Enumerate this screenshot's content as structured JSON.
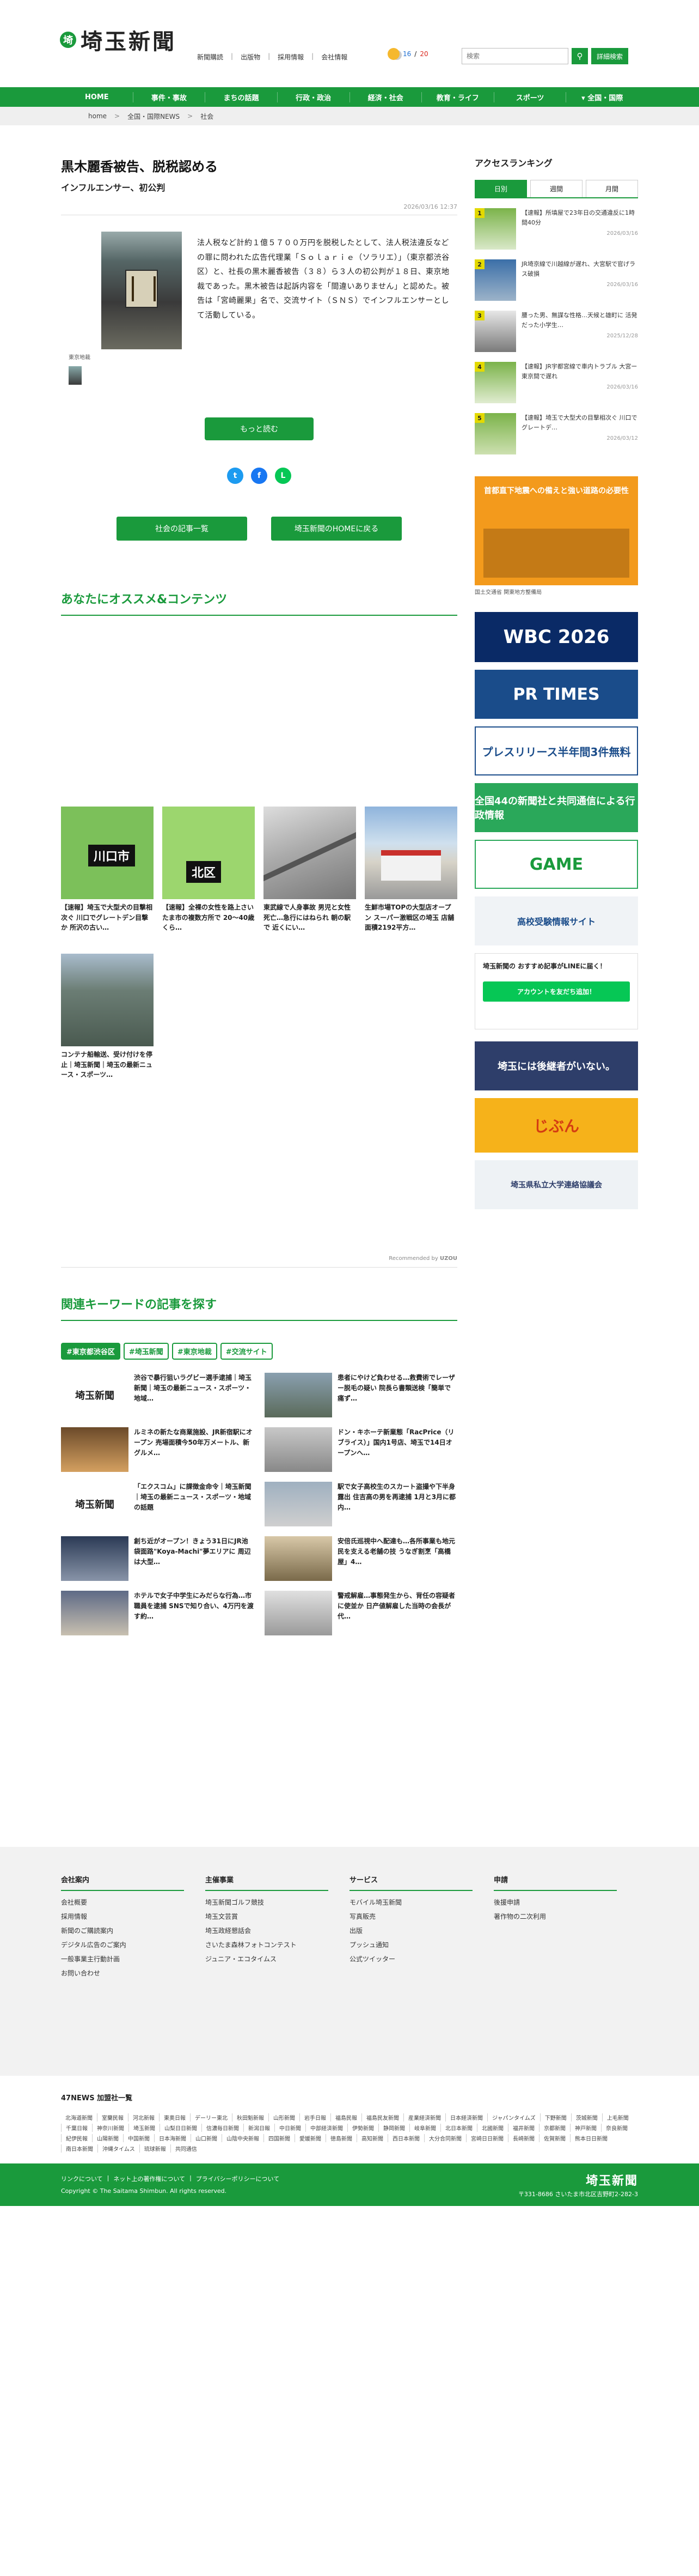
{
  "header": {
    "logo_mark": "埼",
    "logo_text": "埼玉新聞",
    "links": [
      "新聞購読",
      "出版物",
      "採用情報",
      "会社情報"
    ],
    "weather": {
      "lo": "16",
      "hi": "20"
    },
    "search_placeholder": "検索",
    "search_icon": "search-icon",
    "advanced_label": "詳細検索"
  },
  "nav": [
    "HOME",
    "事件・事故",
    "まちの話題",
    "行政・政治",
    "経済・社会",
    "教育・ライフ",
    "スポーツ",
    "全国・国際"
  ],
  "breadcrumb": [
    "home",
    "全国・国際NEWS",
    "社会"
  ],
  "article": {
    "title": "黒木麗香被告、脱税認める",
    "subtitle": "インフルエンサー、初公判",
    "date": "2026/03/16 12:37",
    "caption": "東京地裁",
    "body": "法人税など計約１億５７００万円を脱税したとして、法人税法違反などの罪に問われた広告代理業「Ｓｏｌａｒｉｅ（ソラリエ）」（東京都渋谷区）と、社長の黒木麗香被告（３８）ら３人の初公判が１８日、東京地裁であった。黒木被告は起訴内容を「間違いありません」と認めた。被告は「宮崎麗果」名で、交流サイト（ＳＮＳ）でインフルエンサーとして活動している。",
    "more_label": "もっと読む",
    "btn_list": "社会の記事一覧",
    "btn_home": "埼玉新聞のHOMEに戻る"
  },
  "recommend": {
    "title": "あなたにオススメ&コンテンツ",
    "items": [
      {
        "title": "【速報】埼玉で大型犬の目撃相次ぐ 川口でグレートデン目撃か 所沢の古い…",
        "label": "川口市"
      },
      {
        "title": "【速報】全裸の女性を路上さいたま市の複数方所で 20〜40歳くら…",
        "label": "北区"
      },
      {
        "title": "東武線で人身事故 男児と女性死亡…急行にはねられ 朝の駅で 近くにい…",
        "label": ""
      },
      {
        "title": "生鮮市場TOPの大型店オープン スーパー激戦区の埼玉 店舗面積2192平方…",
        "label": ""
      },
      {
        "title": "コンテナ船輸送、受け付けを停止｜埼玉新聞｜埼玉の最新ニュース・スポーツ…",
        "label": ""
      }
    ],
    "note": "Recommended by"
  },
  "keywords": {
    "title": "関連キーワードの記事を探す",
    "tags": [
      "#東京都渋谷区",
      "#埼玉新聞",
      "#東京地裁",
      "#交流サイト"
    ],
    "items": [
      "渋谷で暴行狙いラグビー選手逮捕｜埼玉新聞｜埼玉の最新ニュース・スポーツ・地域…",
      "患者にやけど負わせる…救費術でレーザー脱毛の疑い 院長ら書類送検「簡単で痛ず…",
      "ルミネの新たな商業施設、JR新宿駅にオープン 売場面積今50年万メートル、新グルメ…",
      "ドン・キホーテ新業態「RacPrice（リブライス）」国内1号店、埼玉で14日オープンへ…",
      "「エクスコム」に課徴金命令｜埼玉新聞｜埼玉の最新ニュース・スポーツ・地域の話題",
      "駅で女子高校生のスカート盗撮や下半身露出 住吉高の男を再逮捕 1月と3月に都内…",
      "創ち近がオープン！きょう31日にJR池袋面路\"Koya-Machi\"夢エリアに 周辺は大型…",
      "安倍氏巡視中へ配達も…各所事業も地元民を支える老舗の技 うなぎ割烹「高橋屋」4…",
      "ホテルで女子中学生にみだらな行為…市職員を逮捕 SNSで知り合い、4万円を渡す約…",
      "警戒解雇…事態発生から、背任の容疑者に使並か 日产値解雇した当時の会長が代…"
    ]
  },
  "sidebar": {
    "title": "アクセスランキング",
    "tabs": [
      "日別",
      "週間",
      "月間"
    ],
    "ranking": [
      {
        "rank": "1",
        "text": "【速報】所填屋で23年日の交通違反に1時間40分",
        "date": "2026/03/16"
      },
      {
        "rank": "2",
        "text": "JR埼京線で川越線が遅れ、大宮駅で官げラス破損",
        "date": "2026/03/16"
      },
      {
        "rank": "3",
        "text": "腰った男、無謀な性格…天候と雄町に 活発だった小学生…",
        "date": "2025/12/28"
      },
      {
        "rank": "4",
        "text": "【速報】JR宇都宮線で車内トラブル 大宮ー東京間で遅れ",
        "date": "2026/03/16"
      },
      {
        "rank": "5",
        "text": "【速報】埼玉で大型犬の目撃相次ぐ 川口でグレートデ…",
        "date": "2026/03/12"
      }
    ],
    "ads": {
      "a1_title": "首都直下地震への備えと強い道路の必要性",
      "a1_caption": "国土交通省 関東地方整備局",
      "wbc": "WBC 2026",
      "prt": "PR TIMES",
      "pr3": "プレスリリース半年間3件無料",
      "n44": "全国44の新聞社と共同通信による行政情報",
      "game": "GAME",
      "edu": "高校受験情報サイト",
      "line_title": "埼玉新聞の おすすめ記事がLINEに届く！",
      "line_btn": "アカウントを友だち追加！",
      "tr": "埼玉には後継者がいない。",
      "ji": "じぶん",
      "uni": "埼玉県私立大学連絡協議会"
    }
  },
  "footer": {
    "cols": [
      {
        "h": "会社案内",
        "items": [
          "会社概要",
          "採用情報",
          "新聞のご購読案内",
          "デジタル広告のご案内",
          "一般事業主行動計画",
          "お問い合わせ"
        ]
      },
      {
        "h": "主催事業",
        "items": [
          "埼玉新聞ゴルフ競技",
          "埼玉文芸賞",
          "埼玉政経懇話会",
          "さいたま森林フォトコンテスト",
          "ジュニア・エコタイムス"
        ]
      },
      {
        "h": "サービス",
        "items": [
          "モバイル埼玉新聞",
          "写真販売",
          "出版",
          "プッシュ通知",
          "公式ツイッター"
        ]
      },
      {
        "h": "申請",
        "items": [
          "後援申請",
          "著作物の二次利用"
        ]
      }
    ],
    "news47_title": "47NEWS 加盟社一覧",
    "papers": [
      "北海道新聞",
      "室蘭民報",
      "河北新報",
      "東奥日報",
      "デーリー東北",
      "秋田魁新報",
      "山形新聞",
      "岩手日報",
      "福島民報",
      "福島民友新聞",
      "産業経済新聞",
      "日本経済新聞",
      "ジャパンタイムズ",
      "下野新聞",
      "茨城新聞",
      "上毛新聞",
      "千葉日報",
      "神奈川新聞",
      "埼玉新聞",
      "山梨日日新聞",
      "信濃毎日新聞",
      "新潟日報",
      "中日新聞",
      "中部経済新聞",
      "伊勢新聞",
      "静岡新聞",
      "岐阜新聞",
      "北日本新聞",
      "北國新聞",
      "福井新聞",
      "京都新聞",
      "神戸新聞",
      "奈良新聞",
      "紀伊民報",
      "山陽新聞",
      "中国新聞",
      "日本海新聞",
      "山口新聞",
      "山陰中央新報",
      "四国新聞",
      "愛媛新聞",
      "徳島新聞",
      "高知新聞",
      "西日本新聞",
      "大分合同新聞",
      "宮崎日日新聞",
      "長崎新聞",
      "佐賀新聞",
      "熊本日日新聞",
      "南日本新聞",
      "沖縄タイムス",
      "琉球新報",
      "共同通信"
    ],
    "bottom_links": [
      "リンクについて",
      "ネット上の著作権について",
      "プライバシーポリシーについて"
    ],
    "copyright": "Copyright © The Saitama Shimbun. All rights reserved.",
    "logo": "埼玉新聞",
    "address": "〒331-8686 さいたま市北区吉野町2-282-3"
  }
}
